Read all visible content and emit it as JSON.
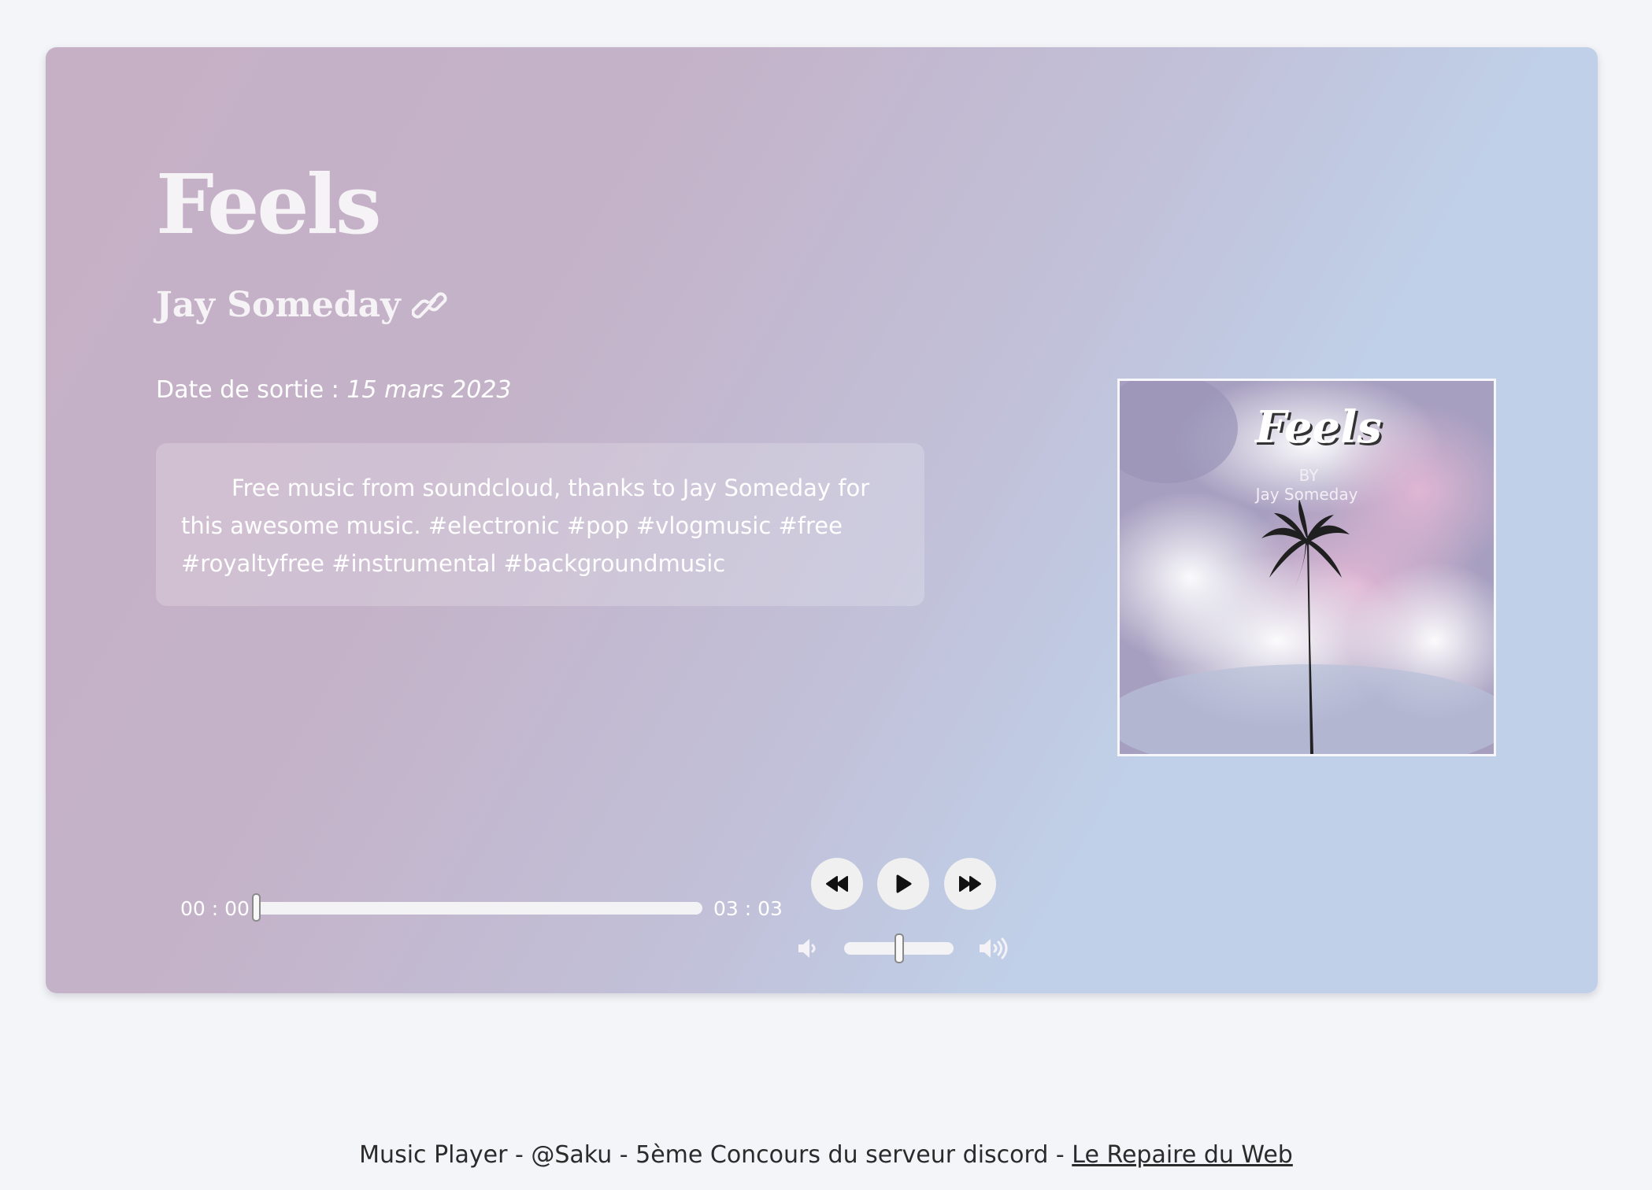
{
  "track": {
    "title": "Feels",
    "artist": "Jay Someday",
    "release_label": "Date de sortie : ",
    "release_date": "15 mars 2023",
    "description": "Free music from soundcloud, thanks to Jay Someday for this awesome music. #electronic #pop #vlogmusic #free #royaltyfree #instrumental #backgroundmusic"
  },
  "cover": {
    "title": "Feels",
    "by": "BY",
    "artist": "Jay Someday"
  },
  "player": {
    "current_time": "00 : 00",
    "total_time": "03 : 03",
    "progress": 0,
    "volume": 0.5
  },
  "icons": {
    "artist_link": "link-icon",
    "rewind": "rewind-icon",
    "play": "play-icon",
    "forward": "fast-forward-icon",
    "volume_down": "volume-down-icon",
    "volume_up": "volume-up-icon"
  },
  "footer": {
    "text": "Music Player - @Saku - 5ème Concours du serveur discord - ",
    "link_label": "Le Repaire du Web"
  }
}
